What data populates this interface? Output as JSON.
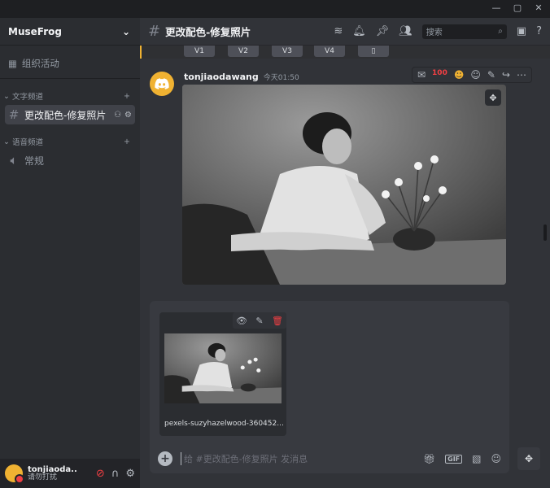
{
  "server": {
    "name": "MuseFrog"
  },
  "sidebar": {
    "events_label": "组织活动",
    "text_category": "文字频道",
    "text_channel": "更改配色-修复照片",
    "voice_category": "语音频道",
    "voice_channel": "常规"
  },
  "user": {
    "name": "tonjiaoda...",
    "status": "请勿打扰"
  },
  "header": {
    "channel": "更改配色-修复照片",
    "search_placeholder": "搜索"
  },
  "variation_buttons": [
    "V1",
    "V2",
    "V3",
    "V4"
  ],
  "message": {
    "author": "tonjiaodawang",
    "time": "今天01:50"
  },
  "attachment": {
    "filename": "pexels-suzyhazelwood-360452..."
  },
  "composer": {
    "placeholder": "给 #更改配色-修复照片 发消息"
  },
  "colors": {
    "accent": "#f0b232",
    "danger": "#f23f43",
    "bg": "#313338"
  }
}
